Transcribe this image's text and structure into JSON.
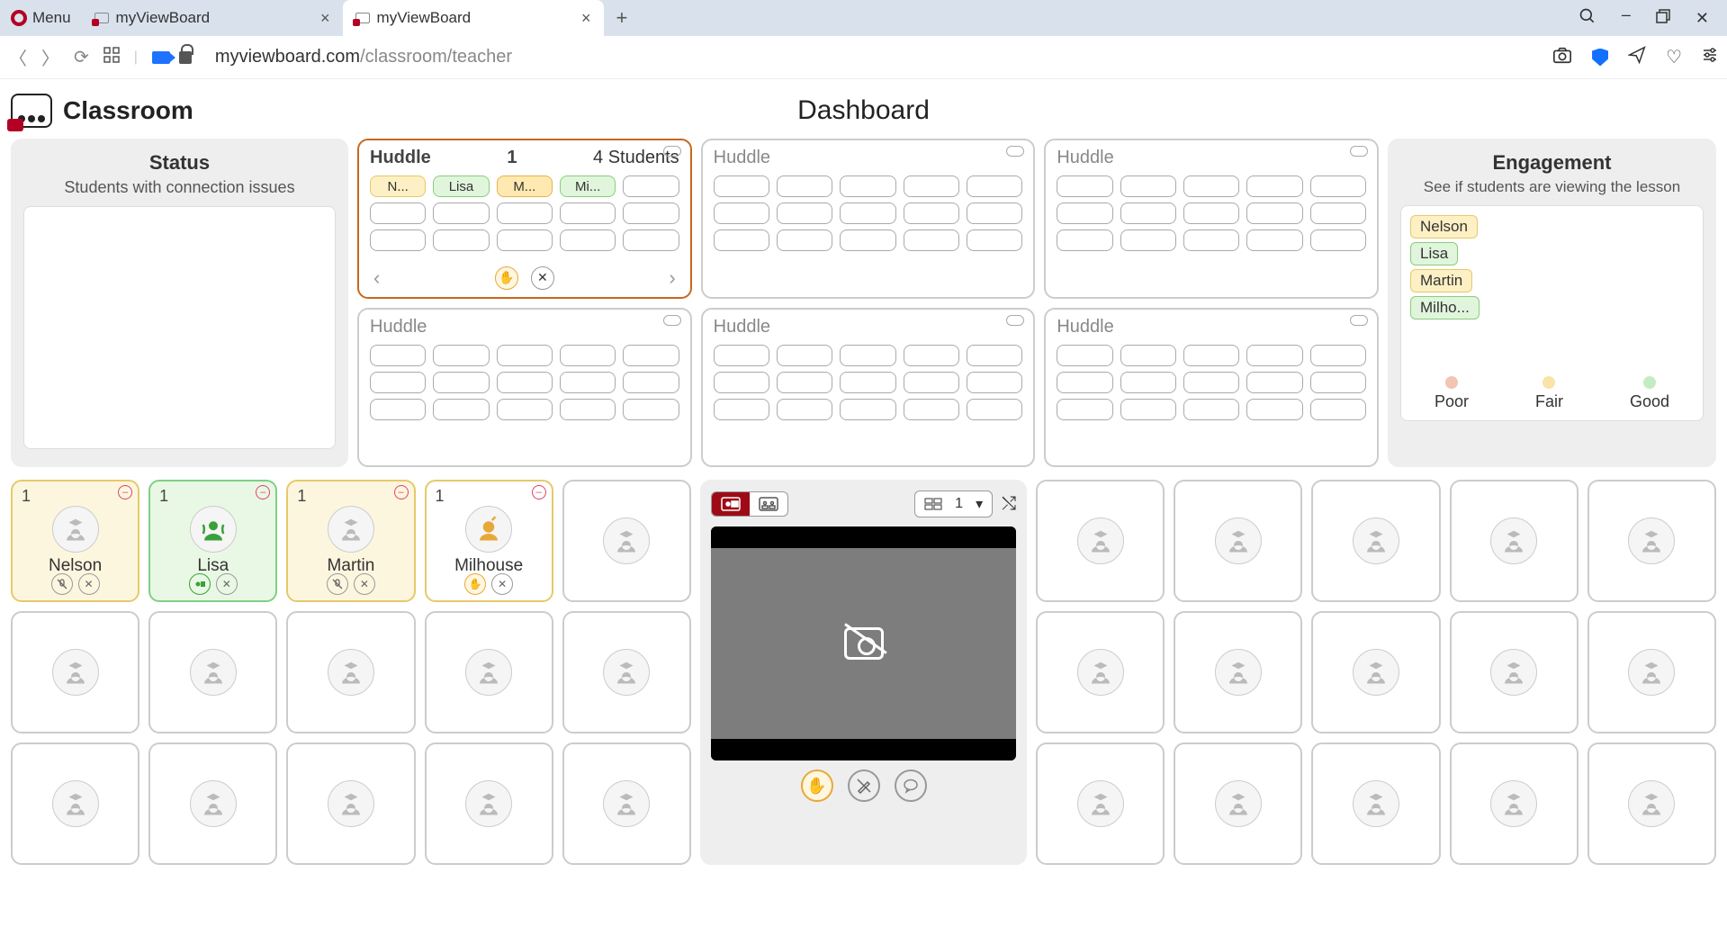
{
  "browser": {
    "menu": "Menu",
    "tabs": [
      {
        "title": "myViewBoard",
        "active": false
      },
      {
        "title": "myViewBoard",
        "active": true
      }
    ],
    "url_host": "myviewboard.com",
    "url_path": "/classroom/teacher"
  },
  "header": {
    "app_name": "Classroom",
    "page_title": "Dashboard"
  },
  "status": {
    "title": "Status",
    "subtitle": "Students with connection issues"
  },
  "engagement": {
    "title": "Engagement",
    "subtitle": "See if students are viewing the lesson",
    "students": [
      {
        "name": "Nelson",
        "level": "fair"
      },
      {
        "name": "Lisa",
        "level": "good"
      },
      {
        "name": "Martin",
        "level": "fair"
      },
      {
        "name": "Milho...",
        "level": "good"
      }
    ],
    "legend": {
      "poor": "Poor",
      "fair": "Fair",
      "good": "Good"
    }
  },
  "huddles": [
    {
      "label": "Huddle",
      "number": "1",
      "count": "4 Students",
      "active": true,
      "students": [
        {
          "name": "N...",
          "cls": "y"
        },
        {
          "name": "Lisa",
          "cls": "g"
        },
        {
          "name": "M...",
          "cls": "o"
        },
        {
          "name": "Mi...",
          "cls": "g"
        }
      ]
    },
    {
      "label": "Huddle",
      "active": false,
      "students": []
    },
    {
      "label": "Huddle",
      "active": false,
      "students": []
    },
    {
      "label": "Huddle",
      "active": false,
      "students": []
    },
    {
      "label": "Huddle",
      "active": false,
      "students": []
    },
    {
      "label": "Huddle",
      "active": false,
      "students": []
    }
  ],
  "student_cards": {
    "left": [
      {
        "name": "Nelson",
        "num": "1",
        "cls": "y",
        "avatar": "grad",
        "icons": [
          "mute",
          "close"
        ]
      },
      {
        "name": "Lisa",
        "num": "1",
        "cls": "g",
        "avatar": "broadcast",
        "icons": [
          "present-green",
          "close"
        ]
      },
      {
        "name": "Martin",
        "num": "1",
        "cls": "y",
        "avatar": "grad",
        "icons": [
          "mute",
          "close"
        ]
      },
      {
        "name": "Milhouse",
        "num": "1",
        "cls": "w",
        "avatar": "hand",
        "icons": [
          "hand-orange",
          "close"
        ]
      },
      {
        "name": "",
        "cls": "",
        "avatar": "grad"
      },
      {
        "name": "",
        "cls": "",
        "avatar": "grad"
      },
      {
        "name": "",
        "cls": "",
        "avatar": "grad"
      },
      {
        "name": "",
        "cls": "",
        "avatar": "grad"
      },
      {
        "name": "",
        "cls": "",
        "avatar": "grad"
      },
      {
        "name": "",
        "cls": "",
        "avatar": "grad"
      },
      {
        "name": "",
        "cls": "",
        "avatar": "grad"
      },
      {
        "name": "",
        "cls": "",
        "avatar": "grad"
      },
      {
        "name": "",
        "cls": "",
        "avatar": "grad"
      },
      {
        "name": "",
        "cls": "",
        "avatar": "grad"
      },
      {
        "name": "",
        "cls": "",
        "avatar": "grad"
      }
    ],
    "right": [
      {
        "name": "",
        "cls": "",
        "avatar": "grad"
      },
      {
        "name": "",
        "cls": "",
        "avatar": "grad"
      },
      {
        "name": "",
        "cls": "",
        "avatar": "grad"
      },
      {
        "name": "",
        "cls": "",
        "avatar": "grad"
      },
      {
        "name": "",
        "cls": "",
        "avatar": "grad"
      },
      {
        "name": "",
        "cls": "",
        "avatar": "grad"
      },
      {
        "name": "",
        "cls": "",
        "avatar": "grad"
      },
      {
        "name": "",
        "cls": "",
        "avatar": "grad"
      },
      {
        "name": "",
        "cls": "",
        "avatar": "grad"
      },
      {
        "name": "",
        "cls": "",
        "avatar": "grad"
      },
      {
        "name": "",
        "cls": "",
        "avatar": "grad"
      },
      {
        "name": "",
        "cls": "",
        "avatar": "grad"
      },
      {
        "name": "",
        "cls": "",
        "avatar": "grad"
      },
      {
        "name": "",
        "cls": "",
        "avatar": "grad"
      },
      {
        "name": "",
        "cls": "",
        "avatar": "grad"
      }
    ]
  },
  "center": {
    "layout_number": "1"
  }
}
